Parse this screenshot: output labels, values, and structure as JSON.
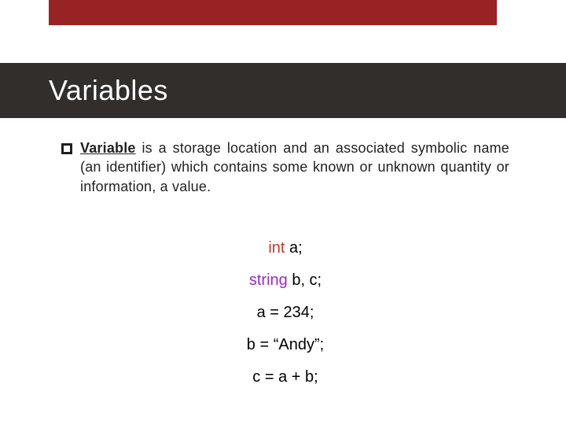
{
  "slide": {
    "title": "Variables",
    "bullet_icon": "square-bullet-icon",
    "definition": {
      "term": "Variable",
      "rest": " is a storage location and an associated symbolic name (an identifier) which contains some known or unknown quantity or information, a value."
    },
    "code": {
      "line1_kw": "int",
      "line1_rest": " a;",
      "line2_kw": "string",
      "line2_rest": " b, c;",
      "line3": "a = 234;",
      "line4": "b = “Andy”;",
      "line5": "c = a + b;"
    }
  }
}
